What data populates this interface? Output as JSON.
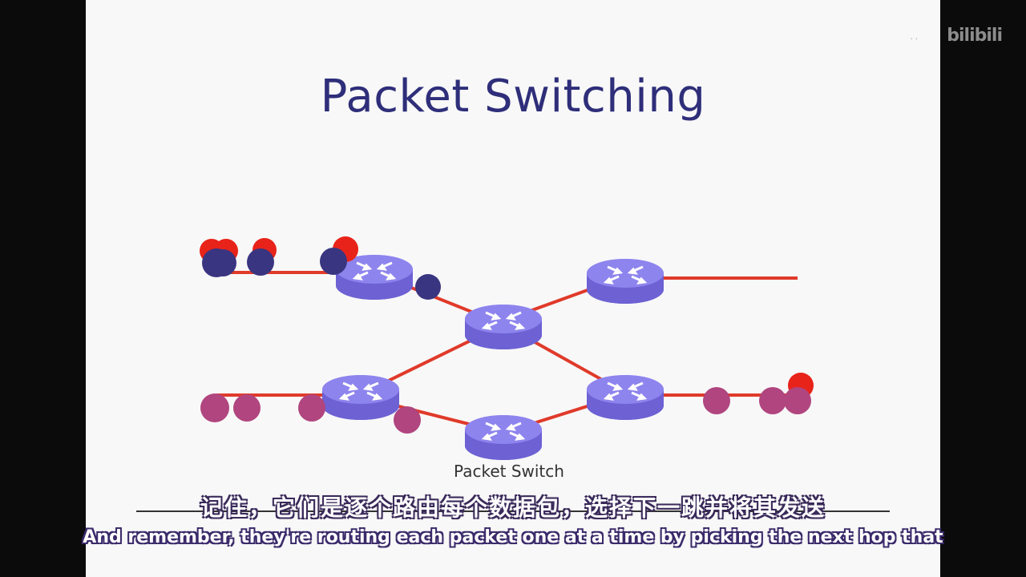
{
  "slide": {
    "title": "Packet Switching",
    "switch_label": "Packet Switch"
  },
  "watermark": {
    "text": "bilibili",
    "dots": "·  ·"
  },
  "subtitles": {
    "chinese": "记住，它们是逐个路由每个数据包，选择下一跳并将其发送",
    "english": "And remember, they're routing each packet one at a time by picking the next hop that"
  },
  "colors": {
    "link": "#e03a2a",
    "router": "#7b6fe0",
    "packet_red": "#e8231a",
    "packet_navy": "#3a3580",
    "packet_magenta": "#b0457f",
    "title": "#2e2e7a"
  }
}
